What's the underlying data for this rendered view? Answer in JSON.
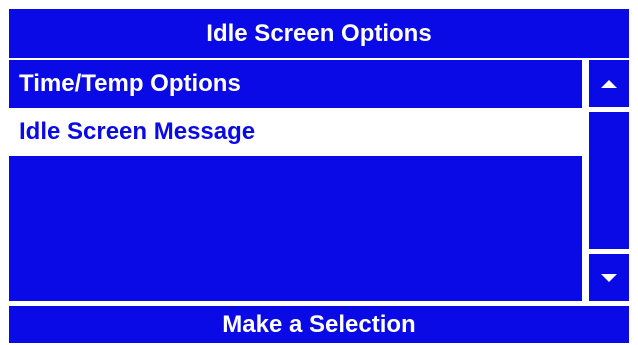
{
  "header": {
    "title": "Idle Screen Options"
  },
  "menu": {
    "items": [
      {
        "label": "Time/Temp Options",
        "selected": false
      },
      {
        "label": "Idle Screen Message",
        "selected": true
      }
    ]
  },
  "scrollbar": {
    "up_icon": "arrow-up-icon",
    "down_icon": "arrow-down-icon"
  },
  "footer": {
    "prompt": "Make a Selection"
  },
  "colors": {
    "accent": "#0a0ae6",
    "highlight_bg": "#ffffff",
    "text_on_accent": "#ffffff"
  }
}
